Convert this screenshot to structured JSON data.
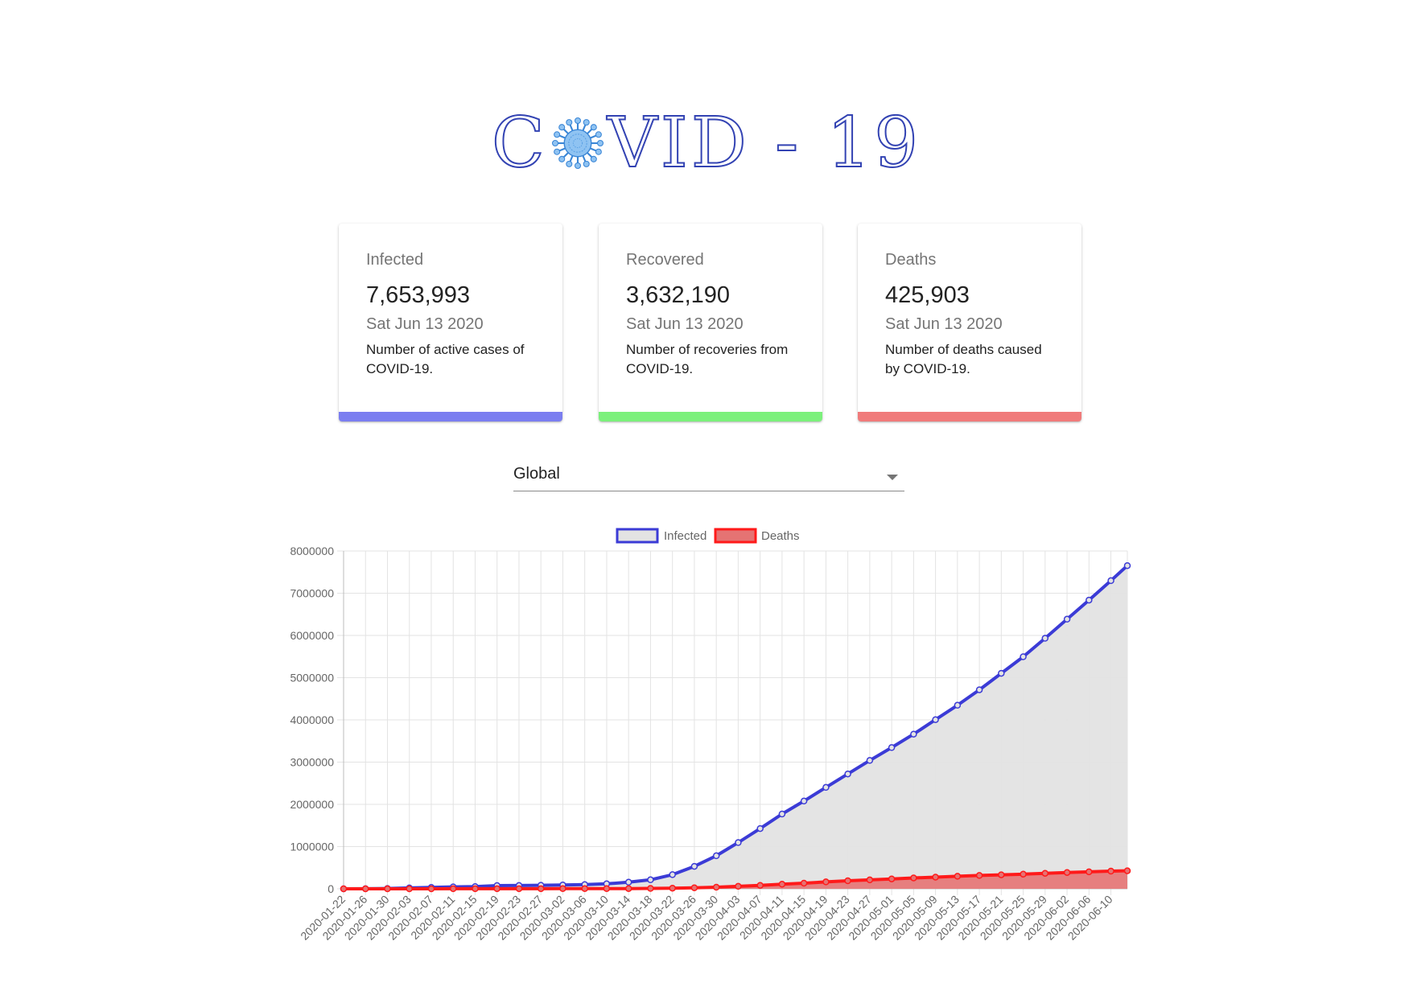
{
  "header": {
    "logo_text_left": "C",
    "logo_text_right": "VID - 19",
    "logo_icon": "coronavirus-icon"
  },
  "cards": [
    {
      "title": "Infected",
      "value": "7,653,993",
      "date": "Sat Jun 13 2020",
      "description": "Number of active cases of COVID-19.",
      "color": "#7b7ef0"
    },
    {
      "title": "Recovered",
      "value": "3,632,190",
      "date": "Sat Jun 13 2020",
      "description": "Number of recoveries from COVID-19.",
      "color": "#7cf07c"
    },
    {
      "title": "Deaths",
      "value": "425,903",
      "date": "Sat Jun 13 2020",
      "description": "Number of deaths caused by COVID-19.",
      "color": "#f07b7b"
    }
  ],
  "country_select": {
    "value": "Global",
    "icon": "chevron-down-icon"
  },
  "chart_data": {
    "type": "line",
    "legend_position": "top",
    "ylim": [
      0,
      8000000
    ],
    "yticks": [
      "0",
      "1000000",
      "2000000",
      "3000000",
      "4000000",
      "5000000",
      "6000000",
      "7000000",
      "8000000"
    ],
    "grid": true,
    "x": [
      "2020-01-22",
      "2020-01-26",
      "2020-01-30",
      "2020-02-03",
      "2020-02-07",
      "2020-02-11",
      "2020-02-15",
      "2020-02-19",
      "2020-02-23",
      "2020-02-27",
      "2020-03-02",
      "2020-03-06",
      "2020-03-10",
      "2020-03-14",
      "2020-03-18",
      "2020-03-22",
      "2020-03-26",
      "2020-03-30",
      "2020-04-03",
      "2020-04-07",
      "2020-04-11",
      "2020-04-15",
      "2020-04-19",
      "2020-04-23",
      "2020-04-27",
      "2020-05-01",
      "2020-05-05",
      "2020-05-09",
      "2020-05-13",
      "2020-05-17",
      "2020-05-21",
      "2020-05-25",
      "2020-05-29",
      "2020-06-02",
      "2020-06-06",
      "2020-06-10",
      "2020-06-13"
    ],
    "x_tick_labels": [
      "2020-01-22",
      "2020-01-26",
      "2020-01-30",
      "2020-02-03",
      "2020-02-07",
      "2020-02-11",
      "2020-02-15",
      "2020-02-19",
      "2020-02-23",
      "2020-02-27",
      "2020-03-02",
      "2020-03-06",
      "2020-03-10",
      "2020-03-14",
      "2020-03-18",
      "2020-03-22",
      "2020-03-26",
      "2020-03-30",
      "2020-04-03",
      "2020-04-07",
      "2020-04-11",
      "2020-04-15",
      "2020-04-19",
      "2020-04-23",
      "2020-04-27",
      "2020-05-01",
      "2020-05-05",
      "2020-05-09",
      "2020-05-13",
      "2020-05-17",
      "2020-05-21",
      "2020-05-25",
      "2020-05-29",
      "2020-06-02",
      "2020-06-06",
      "2020-06-10"
    ],
    "series": [
      {
        "name": "Infected",
        "color": "#3b3bd6",
        "fill": "#e3e3e3",
        "values": [
          555,
          2118,
          8234,
          20630,
          34393,
          44803,
          50580,
          75641,
          78985,
          83112,
          90306,
          101800,
          118000,
          156000,
          214000,
          336000,
          531000,
          782000,
          1095000,
          1427000,
          1772000,
          2079000,
          2401000,
          2720000,
          3040000,
          3344000,
          3662000,
          4006000,
          4346000,
          4712000,
          5102000,
          5495000,
          5934000,
          6385000,
          6837000,
          7297000,
          7653993
        ]
      },
      {
        "name": "Deaths",
        "color": "#ff1a1a",
        "fill": "#e57373",
        "values": [
          17,
          56,
          171,
          425,
          722,
          1113,
          1526,
          2247,
          2469,
          2800,
          3117,
          3460,
          4262,
          5833,
          8733,
          14651,
          23970,
          37582,
          58243,
          81908,
          108400,
          134100,
          162900,
          190800,
          211500,
          234100,
          257200,
          276200,
          297300,
          315700,
          331900,
          346200,
          367000,
          386200,
          402700,
          418100,
          425903
        ]
      }
    ]
  }
}
